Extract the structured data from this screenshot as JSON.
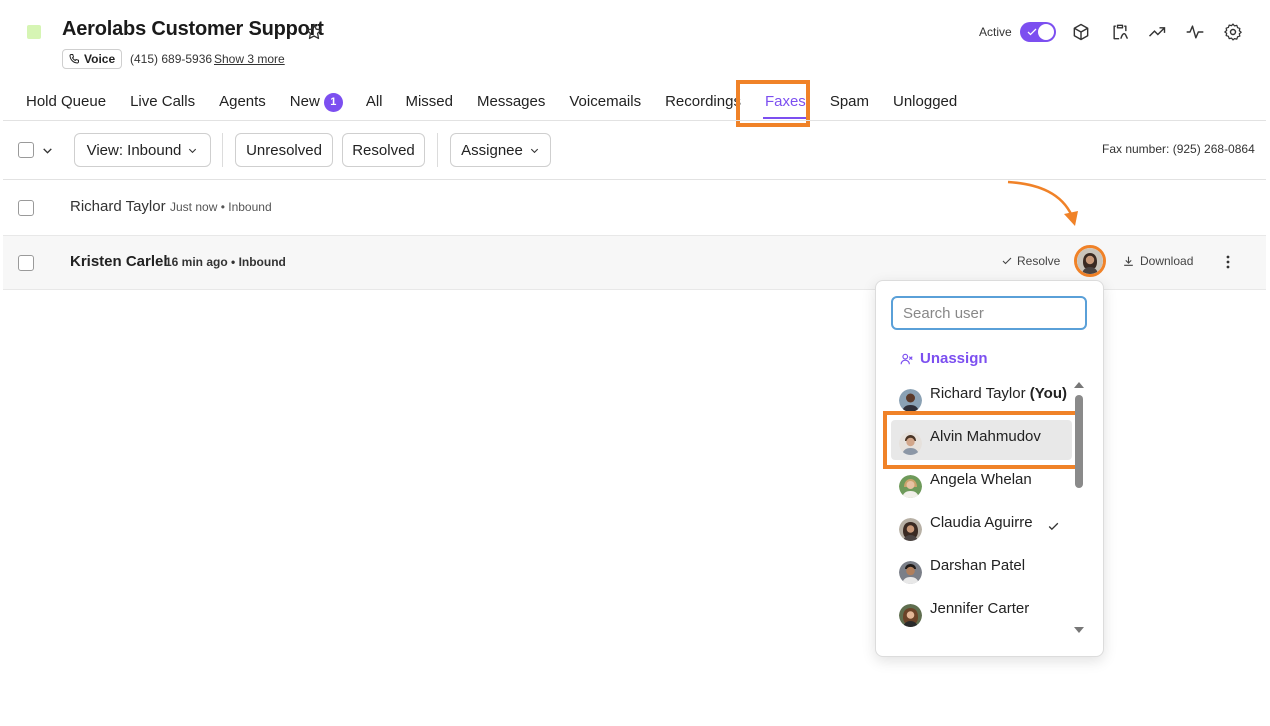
{
  "header": {
    "title": "Aerolabs Customer Support",
    "voice_label": "Voice",
    "phone": "(415) 689-5936",
    "show_more": "Show 3 more",
    "active_label": "Active",
    "logo_color": "#d6f5b4",
    "icons": [
      "cube-icon",
      "clipboard-icon",
      "trend-up-icon",
      "activity-icon",
      "gear-icon"
    ]
  },
  "tabs": [
    {
      "label": "Hold Queue"
    },
    {
      "label": "Live Calls"
    },
    {
      "label": "Agents"
    },
    {
      "label": "New",
      "badge": "1"
    },
    {
      "label": "All"
    },
    {
      "label": "Missed"
    },
    {
      "label": "Messages"
    },
    {
      "label": "Voicemails"
    },
    {
      "label": "Recordings"
    },
    {
      "label": "Faxes",
      "active": true
    },
    {
      "label": "Spam"
    },
    {
      "label": "Unlogged"
    }
  ],
  "toolbar": {
    "view_label": "View: Inbound",
    "unresolved_label": "Unresolved",
    "resolved_label": "Resolved",
    "assignee_label": "Assignee",
    "fax_number": "Fax number: (925) 268-0864"
  },
  "rows": [
    {
      "name": "Richard Taylor",
      "time": "Just now",
      "direction": "Inbound"
    },
    {
      "name": "Kristen Carlel",
      "time": "16 min ago",
      "direction": "Inbound"
    }
  ],
  "row_actions": {
    "resolve_label": "Resolve",
    "download_label": "Download"
  },
  "dropdown": {
    "search_placeholder": "Search user",
    "unassign_label": "Unassign",
    "users": [
      {
        "name": "Richard Taylor",
        "suffix": "(You)"
      },
      {
        "name": "Alvin Mahmudov",
        "selected": true
      },
      {
        "name": "Angela Whelan"
      },
      {
        "name": "Claudia Aguirre",
        "checked": true
      },
      {
        "name": "Darshan Patel"
      },
      {
        "name": "Jennifer Carter"
      }
    ]
  },
  "colors": {
    "accent": "#7c4ff0",
    "highlight": "#f08228",
    "focus": "#5aa0d8"
  }
}
